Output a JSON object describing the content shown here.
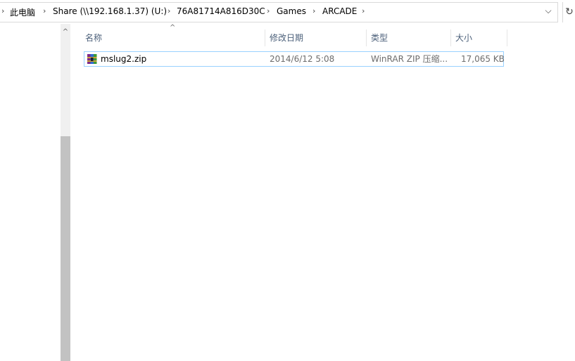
{
  "breadcrumb": {
    "items": [
      "此电脑",
      "Share (\\\\192.168.1.37) (U:)",
      "76A81714A816D30C",
      "Games",
      "ARCADE"
    ],
    "separator": "›"
  },
  "address_bar": {
    "dropdown_icon": "chevron-down-icon",
    "refresh_icon": "refresh-icon",
    "dropdown_glyph": "⌵",
    "refresh_glyph": "↻"
  },
  "columns": {
    "name": "名称",
    "modified": "修改日期",
    "type": "类型",
    "size": "大小",
    "sort_glyph": "^"
  },
  "scrollbar": {
    "up_glyph": "^"
  },
  "files": [
    {
      "name": "mslug2.zip",
      "modified": "2014/6/12 5:08",
      "type": "WinRAR ZIP 压缩...",
      "size": "17,065 KB",
      "icon": "winrar-archive-icon"
    }
  ],
  "colors": {
    "header_text": "#4c607a",
    "selection_border": "#99d1ff",
    "meta_text": "#6d6d6d"
  }
}
